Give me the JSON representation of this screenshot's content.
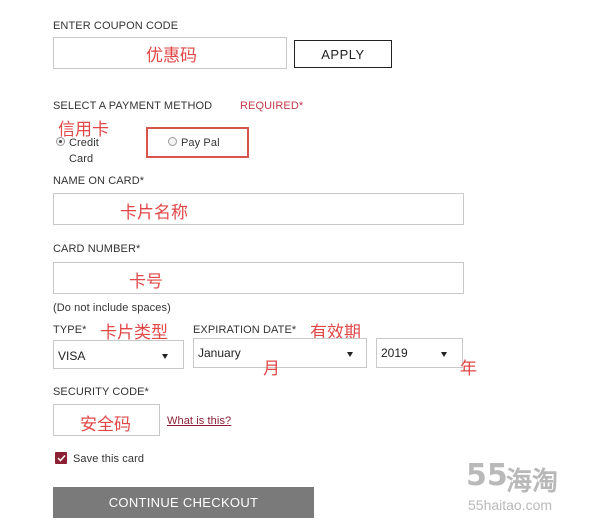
{
  "coupon": {
    "label": "ENTER COUPON CODE",
    "annotation": "优惠码",
    "apply_label": "APPLY"
  },
  "payment": {
    "label": "SELECT A PAYMENT METHOD",
    "required": "REQUIRED*",
    "annotation": "信用卡",
    "credit_line1": "Credit",
    "credit_line2": "Card",
    "paypal_label": "Pay Pal",
    "highlight_color": "#d9534f"
  },
  "name_on_card": {
    "label": "NAME ON CARD*",
    "annotation": "卡片名称"
  },
  "card_number": {
    "label": "CARD NUMBER*",
    "annotation": "卡号",
    "hint": "(Do not include spaces)"
  },
  "type": {
    "label": "TYPE*",
    "annotation": "卡片类型",
    "value": "VISA"
  },
  "expiration": {
    "label": "EXPIRATION DATE*",
    "annotation": "有效期",
    "month_value": "January",
    "month_annotation": "月",
    "year_value": "2019",
    "year_annotation": "年"
  },
  "security": {
    "label": "SECURITY CODE*",
    "annotation": "安全码",
    "help_link": "What is this?"
  },
  "save_card": {
    "label": "Save this card",
    "checked": true
  },
  "continue_label": "CONTINUE CHECKOUT",
  "watermark": {
    "main_digits": "55",
    "main_cjk": "海淘",
    "sub": "55haitao.com"
  },
  "colors": {
    "annotation": "#e04848",
    "accent": "#8b1f33",
    "button_gray": "#7a7a7a"
  }
}
